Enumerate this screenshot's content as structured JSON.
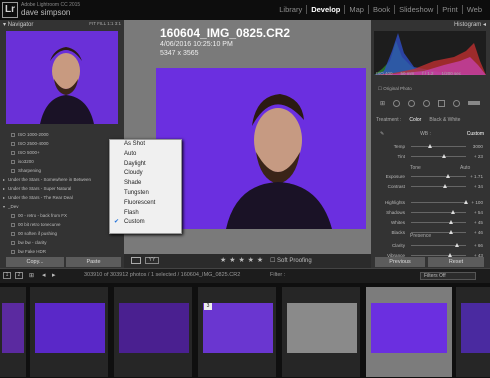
{
  "app": {
    "name": "Adobe Lightroom CC 2015",
    "user": "dave simpson",
    "logo": "Lr"
  },
  "modules": [
    "Library",
    "Develop",
    "Map",
    "Book",
    "Slideshow",
    "Print",
    "Web"
  ],
  "active_module": "Develop",
  "navigator": {
    "title": "Navigator",
    "options": "FIT  FILL  1:1  3:1"
  },
  "presets": [
    {
      "label": "ISO 1000-2000",
      "type": "item"
    },
    {
      "label": "ISO 2500-4000",
      "type": "item"
    },
    {
      "label": "ISO 5000+",
      "type": "item"
    },
    {
      "label": "iso3200",
      "type": "item"
    },
    {
      "label": "Sharpening",
      "type": "item"
    },
    {
      "label": "Under the Stars - Somewhere in Between",
      "type": "folder"
    },
    {
      "label": "Under the Stars - Super Natural",
      "type": "folder"
    },
    {
      "label": "Under the Stars - The Rear Deal",
      "type": "folder"
    },
    {
      "label": "_Dev",
      "type": "folder-open"
    },
    {
      "label": "00 - retro - back from FX",
      "type": "item"
    },
    {
      "label": "00 bit retro tonecurve",
      "type": "item"
    },
    {
      "label": "00 soften if pushing",
      "type": "item"
    },
    {
      "label": "bw bw - clarity",
      "type": "item"
    },
    {
      "label": "bw Fake HDR",
      "type": "item"
    }
  ],
  "left_buttons": {
    "copy": "Copy...",
    "paste": "Paste"
  },
  "photo": {
    "name": "160604_IMG_0825.CR2",
    "date": "4/06/2016 10:25:10 PM",
    "dims": "5347 x 3565"
  },
  "toolbar": {
    "stars": "★ ★ ★ ★ ★",
    "soft_proofing": "Soft Proofing"
  },
  "histogram": {
    "title": "Histogram",
    "iso": "ISO 400",
    "focal": "50 mm",
    "aperture": "f / 1.2",
    "shutter": "1/200 sec",
    "original_photo": "Original Photo"
  },
  "treatment": {
    "label": "Treatment :",
    "color": "Color",
    "bw": "Black & White"
  },
  "wb": {
    "label": "WB :",
    "value": "Custom"
  },
  "sliders_wb": [
    {
      "label": "Temp",
      "value": "3000",
      "pos": 0.35
    },
    {
      "label": "Tint",
      "value": "+ 23",
      "pos": 0.6
    }
  ],
  "tone": {
    "label": "Tone",
    "auto": "Auto"
  },
  "sliders_tone": [
    {
      "label": "Exposure",
      "value": "+ 1.71",
      "pos": 0.68
    },
    {
      "label": "Contrast",
      "value": "+ 34",
      "pos": 0.62
    },
    {
      "label": "Highlights",
      "value": "+ 100",
      "pos": 1.0
    },
    {
      "label": "Shadows",
      "value": "+ 54",
      "pos": 0.77
    },
    {
      "label": "Whites",
      "value": "+ 45",
      "pos": 0.72
    },
    {
      "label": "Blacks",
      "value": "+ 46",
      "pos": 0.73
    }
  ],
  "presence": {
    "label": "Presence"
  },
  "sliders_presence": [
    {
      "label": "Clarity",
      "value": "+ 66",
      "pos": 0.83
    },
    {
      "label": "Vibrance",
      "value": "+ 43",
      "pos": 0.71
    }
  ],
  "right_buttons": {
    "previous": "Previous",
    "reset": "Reset"
  },
  "wb_menu": {
    "items": [
      "As Shot",
      "Auto",
      "Daylight",
      "Cloudy",
      "Shade",
      "Tungsten",
      "Fluorescent",
      "Flash",
      "Custom"
    ],
    "checked": "Custom"
  },
  "filmbar": {
    "info": "303910 of 303912 photos / 1 selected / 160604_IMG_0825.CR2",
    "filter": "Filter :",
    "filters_off": "Filters Off"
  },
  "filmstrip_badge": "3",
  "colors": {
    "accent": "#1e6fd9",
    "photo_bg": "#6b2fe0"
  }
}
